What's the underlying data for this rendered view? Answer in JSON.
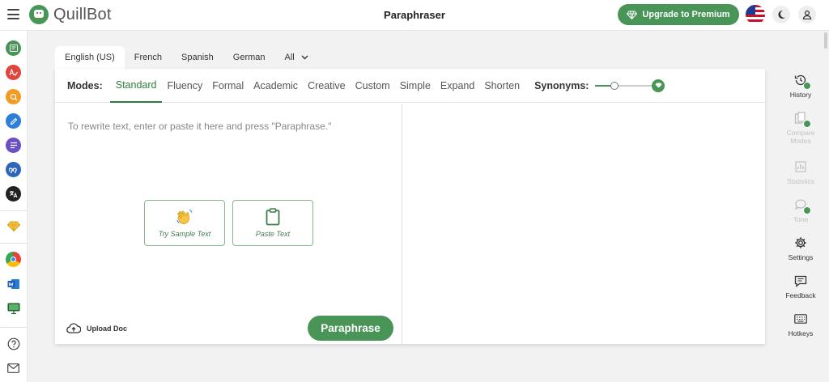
{
  "header": {
    "brand": "QuillBot",
    "title": "Paraphraser",
    "upgrade_label": "Upgrade to Premium"
  },
  "languages": [
    "English (US)",
    "French",
    "Spanish",
    "German",
    "All"
  ],
  "modes_label": "Modes:",
  "modes": [
    "Standard",
    "Fluency",
    "Formal",
    "Academic",
    "Creative",
    "Custom",
    "Simple",
    "Expand",
    "Shorten"
  ],
  "synonyms_label": "Synonyms:",
  "synonyms_level": 0.3,
  "editor": {
    "placeholder": "To rewrite text, enter or paste it here and press \"Paraphrase.\"",
    "try_sample": "Try Sample Text",
    "paste_text": "Paste Text",
    "upload_doc": "Upload Doc",
    "paraphrase": "Paraphrase"
  },
  "right_rail": [
    "History",
    "Compare Modes",
    "Statistics",
    "Tone",
    "Settings",
    "Feedback",
    "Hotkeys"
  ],
  "colors": {
    "brand_green": "#499557",
    "active_mode": "#2e7d3e"
  }
}
